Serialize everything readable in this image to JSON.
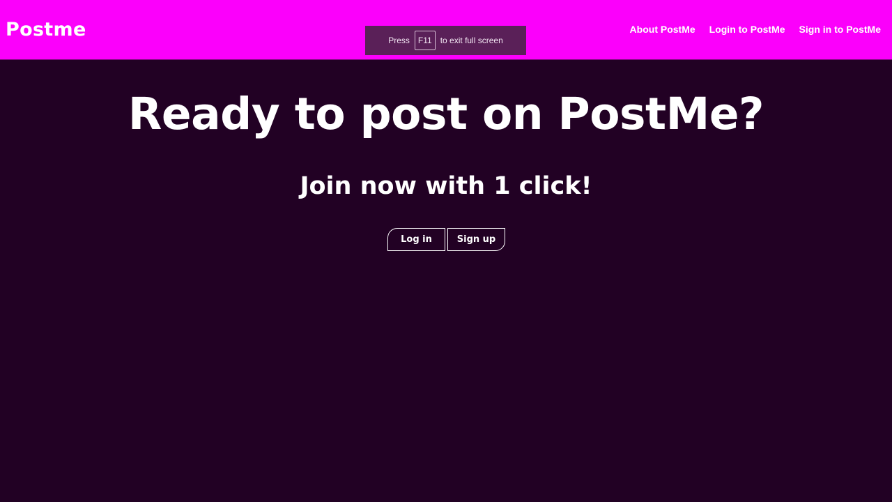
{
  "header": {
    "brand": "Postme",
    "nav": [
      {
        "label": "About PostMe"
      },
      {
        "label": "Login to PostMe"
      },
      {
        "label": "Sign in to PostMe"
      }
    ]
  },
  "fullscreen_notice": {
    "prefix": "Press",
    "key": "F11",
    "suffix": "to exit full screen"
  },
  "hero": {
    "headline": "Ready to post on PostMe?",
    "subline": "Join now with 1 click!",
    "login_label": "Log in",
    "signup_label": "Sign up"
  },
  "colors": {
    "header_bg": "#fb00fb",
    "page_bg": "#220124",
    "text": "#ffffff"
  }
}
